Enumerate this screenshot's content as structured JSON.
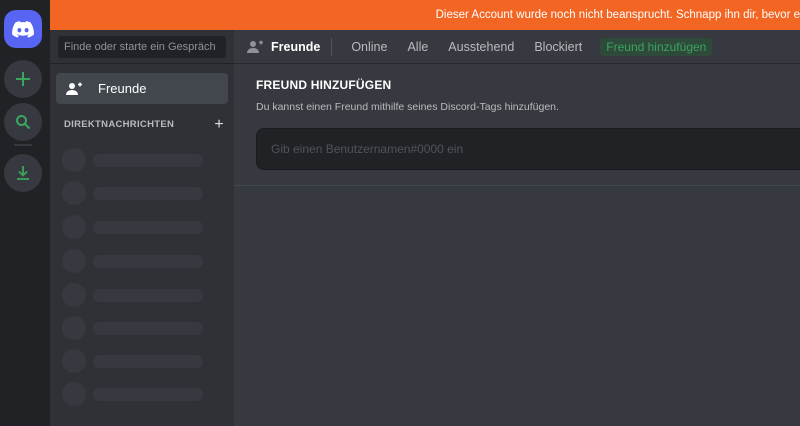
{
  "banner": {
    "text": "Dieser Account wurde noch nicht beansprucht. Schnapp ihn dir, bevor e"
  },
  "rail": {
    "home_icon": "discord-logo-icon",
    "add_icon": "plus-icon",
    "search_icon": "search-icon",
    "download_icon": "download-icon"
  },
  "dm_sidebar": {
    "search_placeholder": "Finde oder starte ein Gespräch",
    "friends_label": "Freunde",
    "friends_icon": "friends-icon",
    "section_title": "DIREKTNACHRICHTEN",
    "add_symbol": "+"
  },
  "topbar": {
    "title": "Freunde",
    "tabs": [
      "Online",
      "Alle",
      "Ausstehend",
      "Blockiert"
    ],
    "add_friend": "Freund hinzufügen"
  },
  "add_friend_panel": {
    "heading": "FREUND HINZUFÜGEN",
    "description": "Du kannst einen Freund mithilfe seines Discord-Tags hinzufügen.",
    "input_placeholder": "Gib einen Benutzernamen#0000 ein"
  },
  "colors": {
    "brand": "#5865f2",
    "banner": "#f26522",
    "accent_green": "#3ba55d"
  }
}
